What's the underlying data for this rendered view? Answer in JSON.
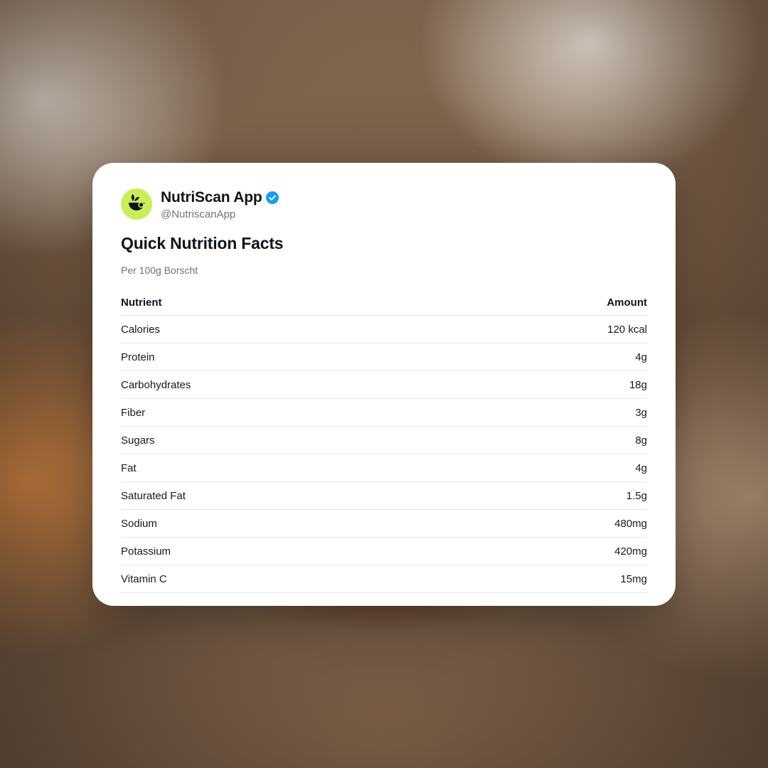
{
  "account": {
    "display_name": "NutriScan App",
    "handle": "@NutriscanApp",
    "verified": true,
    "avatar_color": "#c9ee5b",
    "verified_color": "#1d9bf0"
  },
  "card": {
    "title": "Quick Nutrition Facts",
    "subtitle": "Per 100g Borscht"
  },
  "table": {
    "headers": [
      "Nutrient",
      "Amount"
    ],
    "rows": [
      {
        "nutrient": "Calories",
        "amount": "120 kcal"
      },
      {
        "nutrient": "Protein",
        "amount": "4g"
      },
      {
        "nutrient": "Carbohydrates",
        "amount": "18g"
      },
      {
        "nutrient": "Fiber",
        "amount": "3g"
      },
      {
        "nutrient": "Sugars",
        "amount": "8g"
      },
      {
        "nutrient": "Fat",
        "amount": "4g"
      },
      {
        "nutrient": "Saturated Fat",
        "amount": "1.5g"
      },
      {
        "nutrient": "Sodium",
        "amount": "480mg"
      },
      {
        "nutrient": "Potassium",
        "amount": "420mg"
      },
      {
        "nutrient": "Vitamin C",
        "amount": "15mg"
      }
    ]
  }
}
